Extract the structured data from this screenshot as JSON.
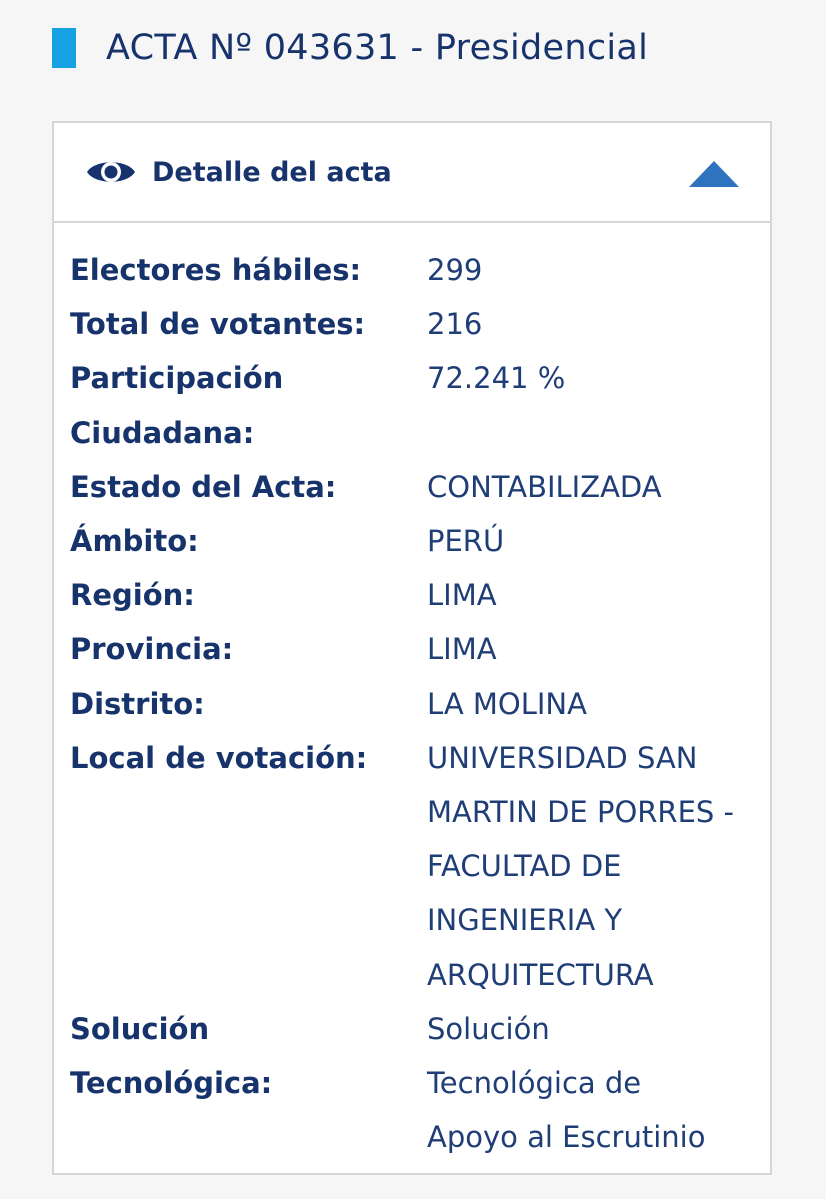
{
  "header": {
    "title": "ACTA Nº 043631 - Presidencial"
  },
  "card": {
    "title": "Detalle del acta",
    "eye_icon": "eye-icon",
    "toggle_icon": "triangle-up-icon",
    "colors": {
      "accent": "#16a2e3",
      "text": "#17336b",
      "toggle": "#2f73be",
      "border": "#d5d6da"
    }
  },
  "details": [
    {
      "label": "Electores hábiles:",
      "value": "299"
    },
    {
      "label": "Total de votantes:",
      "value": "216"
    },
    {
      "label": "Participación",
      "label2": "Ciudadana:",
      "value": "72.241 %"
    },
    {
      "label": "Estado del Acta:",
      "value": "CONTABILIZADA"
    },
    {
      "label": "Ámbito:",
      "value": "PERÚ"
    },
    {
      "label": "Región:",
      "value": "LIMA"
    },
    {
      "label": "Provincia:",
      "value": "LIMA"
    },
    {
      "label": "Distrito:",
      "value": "LA MOLINA"
    },
    {
      "label": "Local de votación:",
      "value_lines": [
        "UNIVERSIDAD SAN",
        "MARTIN DE PORRES -",
        "FACULTAD DE",
        "INGENIERIA Y",
        "ARQUITECTURA"
      ]
    },
    {
      "label": "Solución",
      "label2": "Tecnológica:",
      "value_lines": [
        "Solución",
        "Tecnológica de",
        "Apoyo al Escrutinio"
      ]
    }
  ]
}
